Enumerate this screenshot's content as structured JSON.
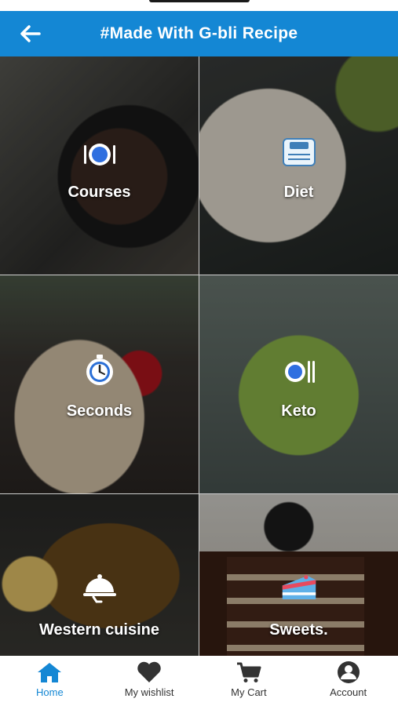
{
  "header": {
    "title": "#Made With G-bli Recipe"
  },
  "categories": [
    {
      "label": "Courses",
      "icon": "plate-cutlery-icon"
    },
    {
      "label": "Diet",
      "icon": "scale-icon"
    },
    {
      "label": "Seconds",
      "icon": "stopwatch-icon"
    },
    {
      "label": "Keto",
      "icon": "plate-cutlery-icon"
    },
    {
      "label": "Western cuisine",
      "icon": "cloche-icon"
    },
    {
      "label": "Sweets.",
      "icon": "cake-icon"
    }
  ],
  "nav": {
    "items": [
      {
        "label": "Home",
        "icon": "home-icon",
        "active": true
      },
      {
        "label": "My wishlist",
        "icon": "heart-icon",
        "active": false
      },
      {
        "label": "My Cart",
        "icon": "cart-icon",
        "active": false
      },
      {
        "label": "Account",
        "icon": "user-icon",
        "active": false
      }
    ]
  },
  "colors": {
    "header": "#1487d4",
    "active_nav": "#1487d4",
    "inactive_nav": "#333333"
  }
}
